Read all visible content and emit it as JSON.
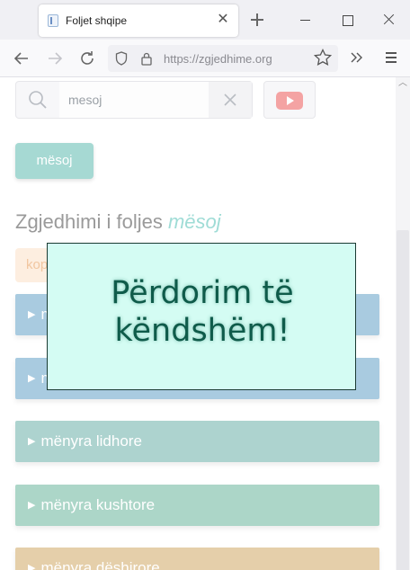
{
  "browser": {
    "tab_title": "Foljet shqipe",
    "tab_close": "✕",
    "url_scheme": "https://",
    "url_host": "zgjedhime.org"
  },
  "search": {
    "value": "mesoj",
    "placeholder": ""
  },
  "verb_button": {
    "label": "mësoj"
  },
  "heading": {
    "prefix": "Zgjedhimi i foljes",
    "verb": "mësoj"
  },
  "copy_chip": {
    "label": "kop"
  },
  "moods": [
    {
      "label": "m",
      "color": "#a9cbe0"
    },
    {
      "label": "m",
      "color": "#a9cbe0"
    },
    {
      "label": "mënyra lidhore",
      "color": "#add3cf"
    },
    {
      "label": "mënyra kushtore",
      "color": "#acd6c8"
    },
    {
      "label": "mënyra dëshirore",
      "color": "#e5cfaa"
    }
  ],
  "overlay": {
    "line1": "Përdorim të",
    "line2": "këndshëm!"
  },
  "colors": {
    "accent": "#a6d9d3",
    "overlay_bg": "#d4fcf3",
    "overlay_text": "#0f5b4a"
  }
}
